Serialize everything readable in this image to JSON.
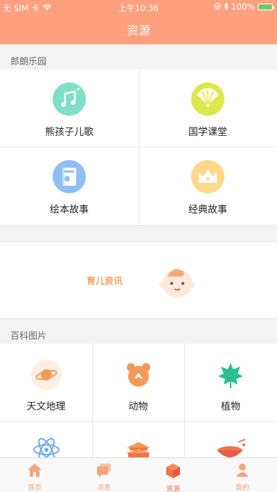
{
  "status_bar": {
    "carrier": "无 SIM 卡",
    "time": "上午10:36",
    "battery": "100%"
  },
  "nav": {
    "title": "资源"
  },
  "section1": {
    "title": "郎朗乐园",
    "items": [
      {
        "label": "熊孩子儿歌",
        "icon": "music-note-icon",
        "color": "#7fe0c7"
      },
      {
        "label": "国学课堂",
        "icon": "folding-fan-icon",
        "color": "#dbe84c"
      },
      {
        "label": "绘本故事",
        "icon": "picture-book-icon",
        "color": "#8ebff5"
      },
      {
        "label": "经典故事",
        "icon": "crown-icon",
        "color": "#ffd88a"
      }
    ]
  },
  "banner": {
    "label": "育儿资讯",
    "icon": "baby-face-icon"
  },
  "section2": {
    "title": "百科图片",
    "items": [
      {
        "label": "天文地理",
        "icon": "planet-icon"
      },
      {
        "label": "动物",
        "icon": "bear-icon"
      },
      {
        "label": "植物",
        "icon": "maple-leaf-icon"
      },
      {
        "label": "",
        "icon": "atom-icon"
      },
      {
        "label": "",
        "icon": "palace-icon"
      },
      {
        "label": "",
        "icon": "bowl-icon"
      }
    ]
  },
  "tabbar": {
    "items": [
      {
        "label": "首页",
        "icon": "home-icon",
        "active": false
      },
      {
        "label": "消息",
        "icon": "message-icon",
        "active": false
      },
      {
        "label": "资源",
        "icon": "box-icon",
        "active": true
      },
      {
        "label": "我的",
        "icon": "person-icon",
        "active": false
      }
    ]
  }
}
